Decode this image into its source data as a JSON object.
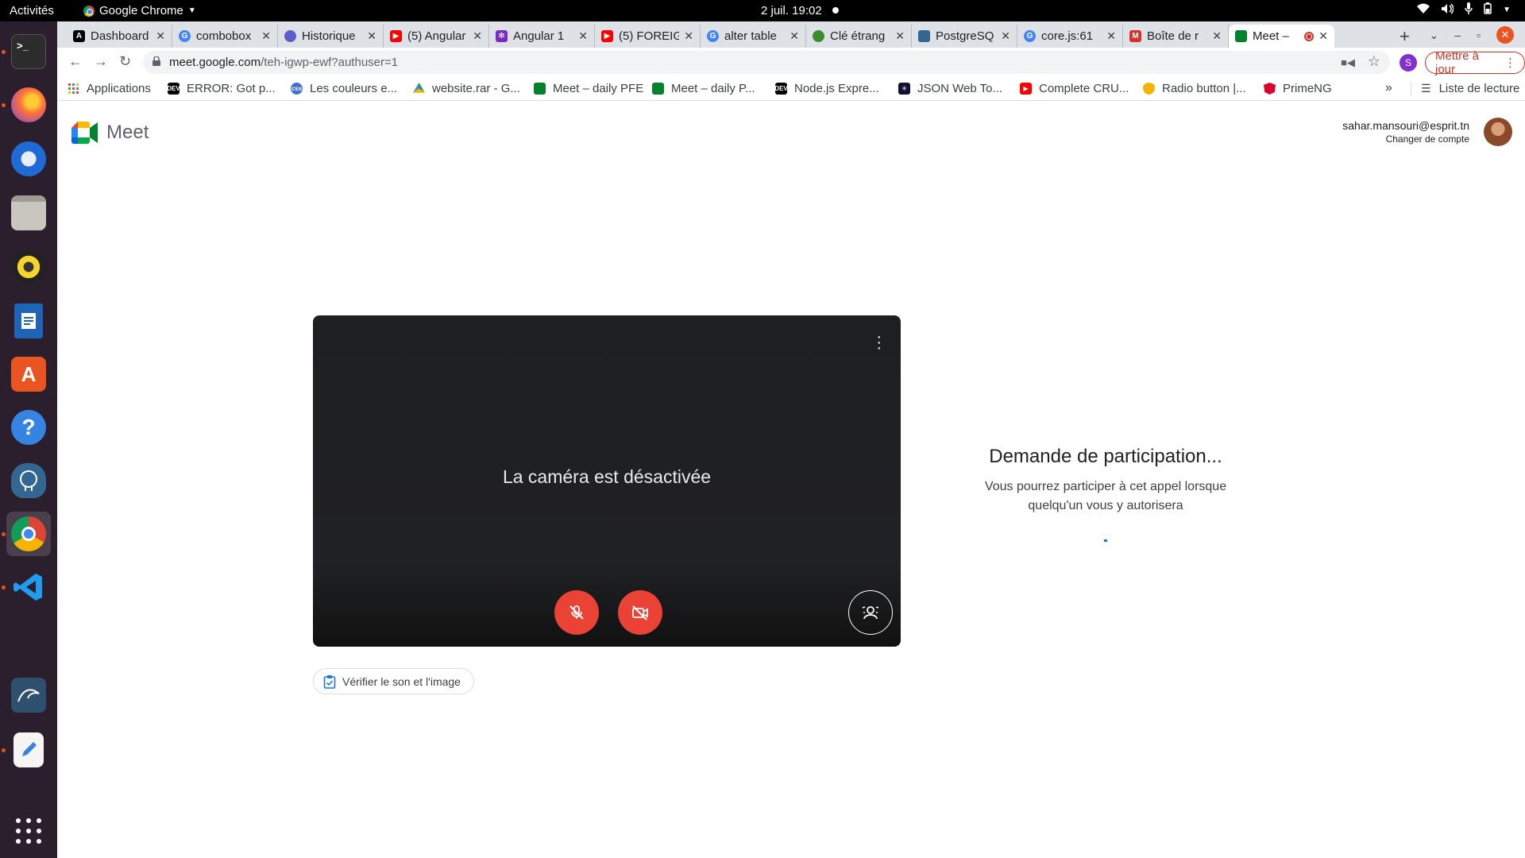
{
  "topbar": {
    "activities": "Activités",
    "app_menu": "Google Chrome",
    "clock": "2 juil.  19:02"
  },
  "dock": {
    "items": [
      "terminal-icon",
      "firefox-icon",
      "thunderbird-icon",
      "files-icon",
      "rhythmbox-icon",
      "writer-icon",
      "software-icon",
      "help-icon",
      "postgres-icon",
      "chrome-icon",
      "vscode-icon",
      "mysql-workbench-icon",
      "text-editor-icon"
    ]
  },
  "tabs": [
    {
      "title": "Dashboard",
      "fav_color": "#000000"
    },
    {
      "title": "combobox",
      "fav_color": "#4285f4"
    },
    {
      "title": "Historique",
      "fav_color": "#5b5fc7"
    },
    {
      "title": "(5) Angular",
      "fav_color": "#ff0000"
    },
    {
      "title": "Angular 1",
      "fav_color": "#7b2cbf"
    },
    {
      "title": "(5) FOREIGN",
      "fav_color": "#ff0000"
    },
    {
      "title": "alter table",
      "fav_color": "#4285f4"
    },
    {
      "title": "Clé étrang",
      "fav_color": "#3c8d2f"
    },
    {
      "title": "PostgreSQ",
      "fav_color": "#336791"
    },
    {
      "title": "core.js:61",
      "fav_color": "#4285f4"
    },
    {
      "title": "Boîte de r",
      "fav_color": "#d93025"
    },
    {
      "title": "Meet –",
      "fav_color": "#00832d"
    }
  ],
  "address": {
    "host": "meet.google.com",
    "path": "/teh-igwp-ewf?authuser=1",
    "profile_initial": "S",
    "update_label": "Mettre à jour"
  },
  "bookmarks": [
    {
      "label": "Applications",
      "fav_color": "#4285f4"
    },
    {
      "label": "ERROR: Got p...",
      "fav_color": "#000000"
    },
    {
      "label": "Les couleurs e...",
      "fav_color": "#3f6fd1"
    },
    {
      "label": "website.rar - G...",
      "fav_color": "#0f9d58"
    },
    {
      "label": "Meet – daily PFE",
      "fav_color": "#00832d"
    },
    {
      "label": "Meet – daily P...",
      "fav_color": "#00832d"
    },
    {
      "label": "Node.js Expre...",
      "fav_color": "#000000"
    },
    {
      "label": "JSON Web To...",
      "fav_color": "#111133"
    },
    {
      "label": "Complete CRU...",
      "fav_color": "#ff0000"
    },
    {
      "label": "Radio button |...",
      "fav_color": "#f4b400"
    },
    {
      "label": "PrimeNG",
      "fav_color": "#dd0031"
    }
  ],
  "reading_list": "Liste de lecture",
  "meet": {
    "logo_text": "Meet",
    "account_email": "sahar.mansouri@esprit.tn",
    "switch_account": "Changer de compte",
    "camera_off_message": "La caméra est désactivée",
    "check_av_label": "Vérifier le son et l'image",
    "join_title": "Demande de participation...",
    "join_text": "Vous pourrez participer à cet appel lorsque quelqu'un vous y autorisera"
  }
}
